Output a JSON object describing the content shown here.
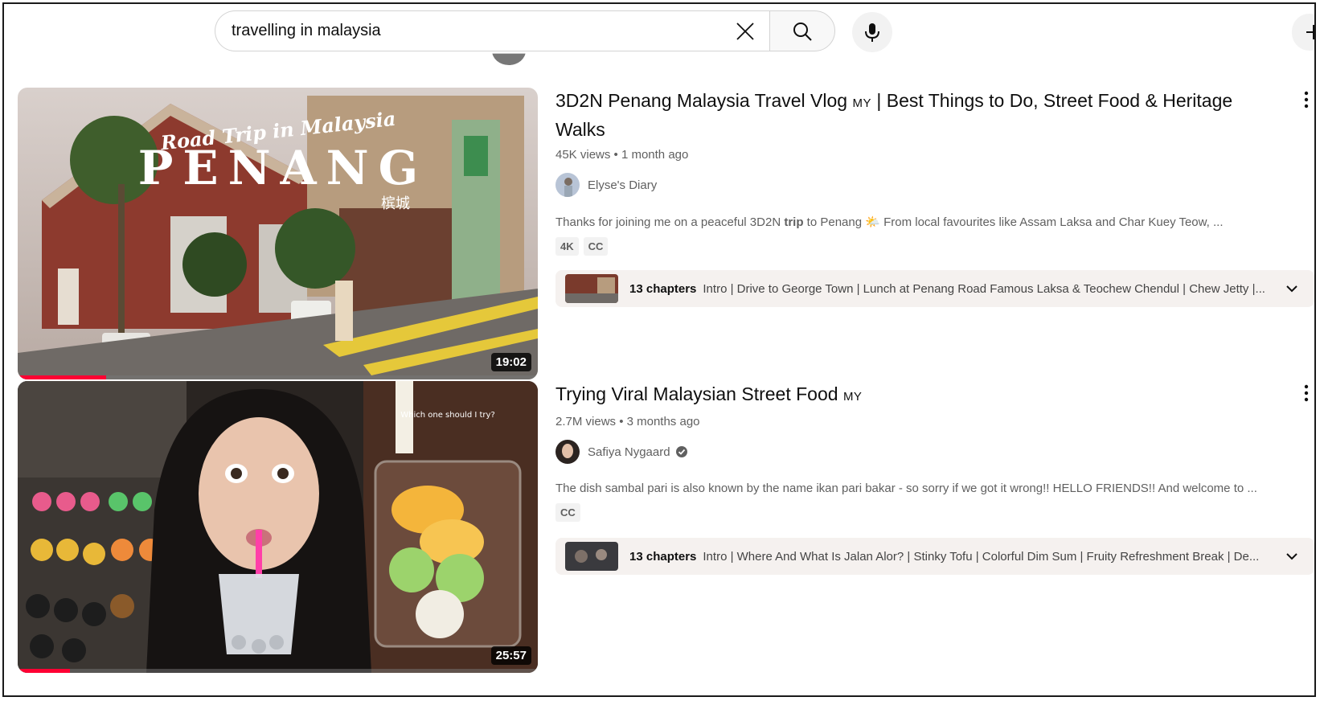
{
  "search": {
    "query": "travelling in malaysia",
    "clear_icon": "close-icon",
    "search_icon": "search-icon",
    "mic_icon": "microphone-icon",
    "create_icon": "plus-icon"
  },
  "results": [
    {
      "thumb_overlay_script": "Road Trip in Malaysia",
      "thumb_overlay_title": "PENANG",
      "thumb_overlay_cn": "槟城",
      "duration": "19:02",
      "watch_progress": 0.17,
      "title": "3D2N Penang Malaysia Travel Vlog",
      "title_flag": "MY",
      "title_rest": "| Best Things to Do, Street Food & Heritage Walks",
      "meta": "45K views • 1 month ago",
      "channel": "Elyse's Diary",
      "verified": false,
      "desc_before": "Thanks for joining me on a peaceful 3D2N ",
      "desc_bold": "trip",
      "desc_after": " to Penang 🌤️ From local favourites like Assam Laksa and Char Kuey Teow, ...",
      "badges": [
        "4K",
        "CC"
      ],
      "chapters_count": "13 chapters",
      "chapters_text": "Intro | Drive to George Town | Lunch at Penang Road Famous Laksa & Teochew Chendul | Chew Jetty |..."
    },
    {
      "duration": "25:57",
      "watch_progress": 0.1,
      "thumb_overlay_caption": "Which one should I try?",
      "title": "Trying Viral Malaysian Street Food",
      "title_flag": "MY",
      "title_rest": "",
      "meta": "2.7M views • 3 months ago",
      "channel": "Safiya Nygaard",
      "verified": true,
      "desc_before": "The dish sambal pari is also known by the name ikan pari bakar - so sorry if we got it wrong!! HELLO FRIENDS!! And welcome to ...",
      "desc_bold": "",
      "desc_after": "",
      "badges": [
        "CC"
      ],
      "chapters_count": "13 chapters",
      "chapters_text": "Intro | Where And What Is Jalan Alor? | Stinky Tofu | Colorful Dim Sum | Fruity Refreshment Break | De..."
    }
  ],
  "colors": {
    "accent_red": "#ff0033",
    "meta_gray": "#606060",
    "chapter_bg": "#f5f1ef"
  }
}
